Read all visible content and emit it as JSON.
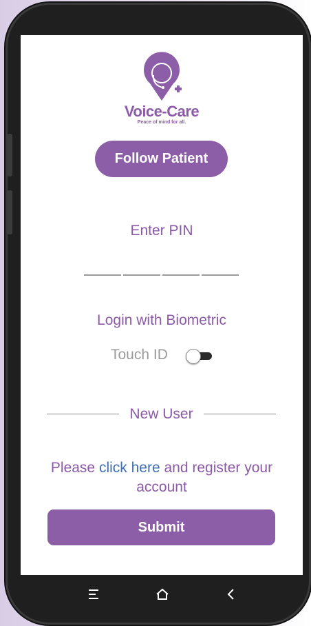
{
  "app": {
    "brand_name": "Voice-Care",
    "tagline": "Peace of mind for all.",
    "colors": {
      "accent": "#8d5ea8",
      "link": "#3f6fb5",
      "muted": "#9a9a9a"
    }
  },
  "header": {
    "follow_button_label": "Follow Patient"
  },
  "pin": {
    "label": "Enter PIN",
    "slot_count": 4
  },
  "biometric": {
    "label": "Login with Biometric",
    "touch_id_label": "Touch ID",
    "touch_id_enabled": false
  },
  "new_user": {
    "divider_label": "New User",
    "register_prefix": "Please ",
    "register_link": "click here",
    "register_suffix": " and register your account"
  },
  "submit": {
    "label": "Submit"
  },
  "navbar": {
    "icons": [
      "menu-icon",
      "home-icon",
      "back-icon"
    ]
  }
}
